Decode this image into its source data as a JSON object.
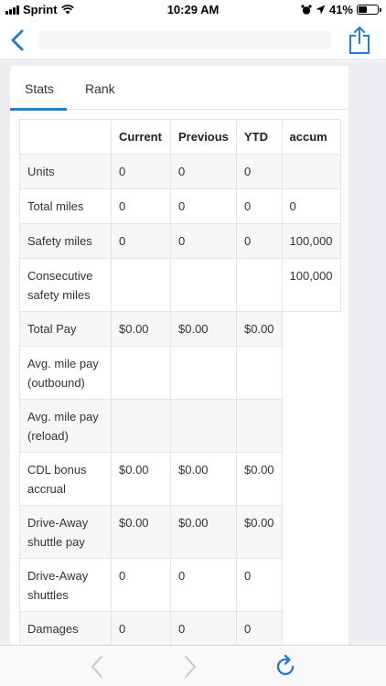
{
  "status_bar": {
    "carrier": "Sprint",
    "time": "10:29 AM",
    "battery": "41%"
  },
  "icons": {
    "back": "chevron-left-icon",
    "share": "share-icon",
    "reload": "reload-icon",
    "forward": "chevron-right-icon"
  },
  "tabs": [
    {
      "label": "Stats",
      "active": true
    },
    {
      "label": "Rank",
      "active": false
    }
  ],
  "table": {
    "headers": [
      "",
      "Current",
      "Previous",
      "YTD",
      "accum"
    ],
    "rows": [
      {
        "label": "Units",
        "current": "0",
        "previous": "0",
        "ytd": "0",
        "accum": ""
      },
      {
        "label": "Total miles",
        "current": "0",
        "previous": "0",
        "ytd": "0",
        "accum": "0"
      },
      {
        "label": "Safety miles",
        "current": "0",
        "previous": "0",
        "ytd": "0",
        "accum": "100,000"
      },
      {
        "label": "Consecutive safety miles",
        "current": "",
        "previous": "",
        "ytd": "",
        "accum": "100,000"
      },
      {
        "label": "Total Pay",
        "current": "$0.00",
        "previous": "$0.00",
        "ytd": "$0.00",
        "accum": null
      },
      {
        "label": "Avg. mile pay (outbound)",
        "current": "",
        "previous": "",
        "ytd": "",
        "accum": null
      },
      {
        "label": "Avg. mile pay (reload)",
        "current": "",
        "previous": "",
        "ytd": "",
        "accum": null
      },
      {
        "label": "CDL bonus accrual",
        "current": "$0.00",
        "previous": "$0.00",
        "ytd": "$0.00",
        "accum": null
      },
      {
        "label": "Drive-Away shuttle pay",
        "current": "$0.00",
        "previous": "$0.00",
        "ytd": "$0.00",
        "accum": null
      },
      {
        "label": "Drive-Away shuttles",
        "current": "0",
        "previous": "0",
        "ytd": "0",
        "accum": null
      },
      {
        "label": "Damages",
        "current": "0",
        "previous": "0",
        "ytd": "0",
        "accum": null
      }
    ]
  },
  "colors": {
    "accent": "#1f7ed8",
    "row_shade": "#f7f7f7",
    "page_bg": "#eeeef2"
  }
}
